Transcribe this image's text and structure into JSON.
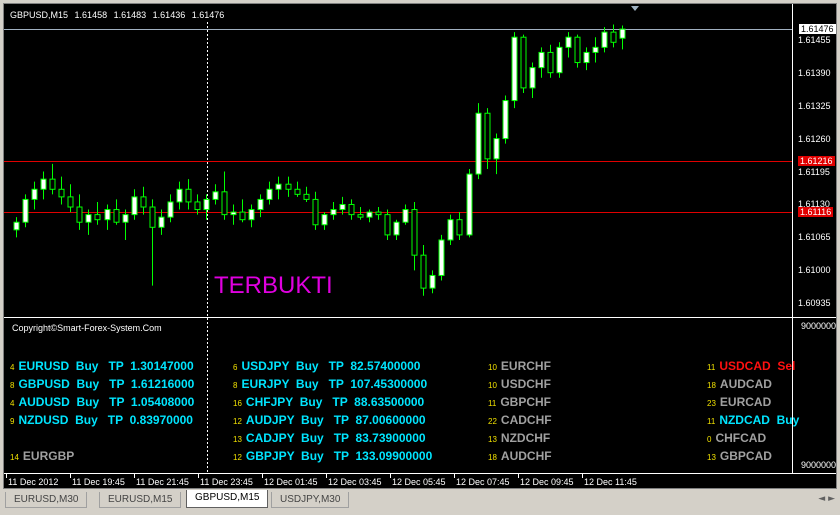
{
  "chart": {
    "header": {
      "symbol": "GBPUSD,M15",
      "open": "1.61458",
      "high": "1.61483",
      "low": "1.61436",
      "close": "1.61476"
    },
    "annotation": "TERBUKTI",
    "price_scale": {
      "current": "1.61476",
      "levels": [
        "1.61455",
        "1.61390",
        "1.61325",
        "1.61260",
        "1.61195",
        "1.61130",
        "1.61065",
        "1.61000",
        "1.60935"
      ],
      "red_levels": [
        "1.61216",
        "1.61116"
      ]
    },
    "time_labels": [
      "11 Dec 2012",
      "11 Dec 19:45",
      "11 Dec 21:45",
      "11 Dec 23:45",
      "12 Dec 01:45",
      "12 Dec 03:45",
      "12 Dec 05:45",
      "12 Dec 07:45",
      "12 Dec 09:45",
      "12 Dec 11:45"
    ],
    "colors": {
      "background": "#000000",
      "bull": "#ffffff",
      "bear": "#000000",
      "wick": "#00ff00",
      "hline": "#e00000",
      "current_line": "#a0b0c0"
    }
  },
  "indicator": {
    "copyright": "Copyright©Smart-Forex-System.Com",
    "scale_top": "9000000",
    "scale_bottom": "9000000",
    "columns": [
      [
        {
          "num": "4",
          "text": "EURUSD  Buy   TP  1.30147000",
          "color": "cyan"
        },
        {
          "num": "8",
          "text": "GBPUSD  Buy   TP  1.61216000",
          "color": "cyan"
        },
        {
          "num": "4",
          "text": "AUDUSD  Buy   TP  1.05408000",
          "color": "cyan"
        },
        {
          "num": "9",
          "text": "NZDUSD  Buy   TP  0.83970000",
          "color": "cyan"
        },
        {
          "num": "",
          "text": "",
          "color": "cyan"
        },
        {
          "num": "14",
          "text": "EURGBP",
          "color": "gray"
        }
      ],
      [
        {
          "num": "6",
          "text": "USDJPY  Buy   TP  82.57400000",
          "color": "cyan"
        },
        {
          "num": "8",
          "text": "EURJPY  Buy   TP  107.45300000",
          "color": "cyan"
        },
        {
          "num": "16",
          "text": "CHFJPY  Buy   TP  88.63500000",
          "color": "cyan"
        },
        {
          "num": "12",
          "text": "AUDJPY  Buy   TP  87.00600000",
          "color": "cyan"
        },
        {
          "num": "13",
          "text": "CADJPY  Buy   TP  83.73900000",
          "color": "cyan"
        },
        {
          "num": "12",
          "text": "GBPJPY  Buy   TP  133.09900000",
          "color": "cyan"
        }
      ],
      [
        {
          "num": "10",
          "text": "EURCHF",
          "color": "gray"
        },
        {
          "num": "10",
          "text": "USDCHF",
          "color": "gray"
        },
        {
          "num": "11",
          "text": "GBPCHF",
          "color": "gray"
        },
        {
          "num": "22",
          "text": "CADCHF",
          "color": "gray"
        },
        {
          "num": "13",
          "text": "NZDCHF",
          "color": "gray"
        },
        {
          "num": "18",
          "text": "AUDCHF",
          "color": "gray"
        }
      ],
      [
        {
          "num": "11",
          "text": "USDCAD  Sel",
          "color": "red"
        },
        {
          "num": "18",
          "text": "AUDCAD",
          "color": "gray"
        },
        {
          "num": "23",
          "text": "EURCAD",
          "color": "gray"
        },
        {
          "num": "11",
          "text": "NZDCAD  Buy",
          "color": "cyan"
        },
        {
          "num": "0",
          "text": "CHFCAD",
          "color": "gray"
        },
        {
          "num": "13",
          "text": "GBPCAD",
          "color": "gray"
        }
      ]
    ]
  },
  "tabs": [
    {
      "label": "EURUSD,M30",
      "active": false
    },
    {
      "label": "EURUSD,M15",
      "active": false
    },
    {
      "label": "GBPUSD,M15",
      "active": true
    },
    {
      "label": "USDJPY,M30",
      "active": false
    }
  ],
  "candles": [
    [
      1.6108,
      1.61105,
      1.61065,
      1.61095
    ],
    [
      1.61095,
      1.6115,
      1.61085,
      1.6114
    ],
    [
      1.6114,
      1.61175,
      1.6112,
      1.6116
    ],
    [
      1.6116,
      1.61195,
      1.6114,
      1.6118
    ],
    [
      1.6118,
      1.6121,
      1.6115,
      1.6116
    ],
    [
      1.6116,
      1.61185,
      1.6113,
      1.61145
    ],
    [
      1.61145,
      1.6117,
      1.61115,
      1.61125
    ],
    [
      1.61125,
      1.6115,
      1.6108,
      1.61095
    ],
    [
      1.61095,
      1.6112,
      1.6107,
      1.6111
    ],
    [
      1.6111,
      1.61135,
      1.6109,
      1.611
    ],
    [
      1.611,
      1.6113,
      1.6108,
      1.6112
    ],
    [
      1.6112,
      1.6114,
      1.6109,
      1.61095
    ],
    [
      1.61095,
      1.6112,
      1.6106,
      1.6111
    ],
    [
      1.6111,
      1.6116,
      1.611,
      1.61145
    ],
    [
      1.61145,
      1.61165,
      1.6111,
      1.61125
    ],
    [
      1.61125,
      1.6114,
      1.6097,
      1.61085
    ],
    [
      1.61085,
      1.6112,
      1.6107,
      1.61105
    ],
    [
      1.61105,
      1.6115,
      1.61095,
      1.61135
    ],
    [
      1.61135,
      1.61175,
      1.6112,
      1.6116
    ],
    [
      1.6116,
      1.6118,
      1.6112,
      1.61135
    ],
    [
      1.61135,
      1.6115,
      1.6111,
      1.6112
    ],
    [
      1.6112,
      1.6115,
      1.611,
      1.6114
    ],
    [
      1.6114,
      1.6117,
      1.6113,
      1.61155
    ],
    [
      1.61155,
      1.61195,
      1.611,
      1.6111
    ],
    [
      1.6111,
      1.6113,
      1.6109,
      1.61115
    ],
    [
      1.61115,
      1.6114,
      1.61095,
      1.611
    ],
    [
      1.611,
      1.6113,
      1.61085,
      1.6112
    ],
    [
      1.6112,
      1.6115,
      1.61105,
      1.6114
    ],
    [
      1.6114,
      1.61175,
      1.6113,
      1.6116
    ],
    [
      1.6116,
      1.61185,
      1.6114,
      1.6117
    ],
    [
      1.6117,
      1.61185,
      1.61145,
      1.6116
    ],
    [
      1.6116,
      1.61175,
      1.61145,
      1.6115
    ],
    [
      1.6115,
      1.61165,
      1.61135,
      1.6114
    ],
    [
      1.6114,
      1.61155,
      1.6108,
      1.6109
    ],
    [
      1.6109,
      1.61115,
      1.6108,
      1.6111
    ],
    [
      1.6111,
      1.61135,
      1.611,
      1.6112
    ],
    [
      1.6112,
      1.61145,
      1.6111,
      1.6113
    ],
    [
      1.6113,
      1.6114,
      1.611,
      1.6111
    ],
    [
      1.6111,
      1.61125,
      1.611,
      1.61105
    ],
    [
      1.61105,
      1.6112,
      1.61095,
      1.61115
    ],
    [
      1.61115,
      1.61125,
      1.611,
      1.6111
    ],
    [
      1.6111,
      1.6112,
      1.6106,
      1.6107
    ],
    [
      1.6107,
      1.611,
      1.6106,
      1.61095
    ],
    [
      1.61095,
      1.6113,
      1.6109,
      1.6112
    ],
    [
      1.6112,
      1.61135,
      1.61,
      1.6103
    ],
    [
      1.6103,
      1.6105,
      1.6095,
      1.60965
    ],
    [
      1.60965,
      1.61,
      1.60955,
      1.6099
    ],
    [
      1.6099,
      1.6107,
      1.6098,
      1.6106
    ],
    [
      1.6106,
      1.6111,
      1.6105,
      1.611
    ],
    [
      1.611,
      1.61115,
      1.6106,
      1.6107
    ],
    [
      1.6107,
      1.612,
      1.61065,
      1.6119
    ],
    [
      1.6119,
      1.6133,
      1.6118,
      1.6131
    ],
    [
      1.6131,
      1.6132,
      1.612,
      1.6122
    ],
    [
      1.6122,
      1.6127,
      1.6119,
      1.6126
    ],
    [
      1.6126,
      1.61345,
      1.6125,
      1.61335
    ],
    [
      1.61335,
      1.6147,
      1.6132,
      1.6146
    ],
    [
      1.6146,
      1.61465,
      1.6135,
      1.6136
    ],
    [
      1.6136,
      1.6141,
      1.6134,
      1.614
    ],
    [
      1.614,
      1.6144,
      1.6138,
      1.6143
    ],
    [
      1.6143,
      1.61445,
      1.6138,
      1.6139
    ],
    [
      1.6139,
      1.6145,
      1.6138,
      1.6144
    ],
    [
      1.6144,
      1.6147,
      1.6142,
      1.6146
    ],
    [
      1.6146,
      1.61465,
      1.614,
      1.6141
    ],
    [
      1.6141,
      1.6144,
      1.61395,
      1.6143
    ],
    [
      1.6143,
      1.6146,
      1.6141,
      1.6144
    ],
    [
      1.6144,
      1.6148,
      1.6143,
      1.6147
    ],
    [
      1.6147,
      1.61485,
      1.6144,
      1.6145
    ],
    [
      1.61458,
      1.61483,
      1.61436,
      1.61476
    ]
  ]
}
